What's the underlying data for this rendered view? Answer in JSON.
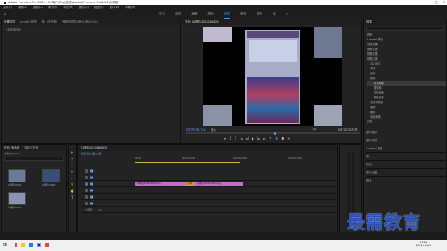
{
  "titlebar": {
    "title": "Adobe Premiere Pro 2020 - C:\\用户\\Ghp\\文档\\Adobe\\Premiere Pro\\14.0\\未命名 *",
    "minimize": "—",
    "maximize": "□",
    "close": "✕"
  },
  "menu": [
    "文件(F)",
    "编辑(E)",
    "剪辑(C)",
    "序列(S)",
    "标记(M)",
    "图形(G)",
    "视图(V)",
    "窗口(W)",
    "帮助(H)"
  ],
  "workspaces": [
    "学习",
    "组件",
    "编辑",
    "颜色",
    "效果",
    "音频",
    "图形",
    "库",
    "»"
  ],
  "active_workspace": "效果",
  "source_panel": {
    "tabs": [
      "效果控件",
      "Lumetri 范围",
      "源：(无剪辑)",
      "音频剪辑混合器:01图片2020"
    ],
    "placeholder": "（未选择剪辑）"
  },
  "program_panel": {
    "tab": "节目: 01图片2020180605",
    "timecode": "00:00:01:03",
    "fit": "适合",
    "quality": "1/2",
    "duration": "00:00:10:00"
  },
  "effects_panel": {
    "tab": "效果",
    "items": [
      "预设",
      "Lumetri 预设",
      "音频效果",
      "音频过渡",
      "视频效果",
      "视频过渡",
      "3D 运动",
      "内滑",
      "划像",
      "擦除",
      "交叉划像",
      "圆划像",
      "盒形划像",
      "菱形划像",
      "沉浸式视频",
      "溶解",
      "缩放",
      "页面剥落",
      "过时"
    ],
    "selected": "交叉划像",
    "sections": [
      "基本图形",
      "基本声音",
      "Lumetri 颜色",
      "库",
      "标记",
      "历史记录",
      "信息"
    ]
  },
  "project_panel": {
    "tabs": [
      "项目: 未命名",
      "媒体浏览器"
    ],
    "name": "未命名.prproj",
    "clips": [
      "01图片2020",
      "02图片2020",
      "03图片2020"
    ]
  },
  "timeline": {
    "tab": "01图片2020180605",
    "timecode": "00:00:01:03",
    "ruler": [
      "00:00",
      "00:00:05:00",
      "00:00:10:00",
      "00:00:15:00"
    ],
    "tracks": [
      "V3",
      "V2",
      "V1",
      "A1",
      "A2",
      "A3",
      "主声道"
    ],
    "master_value": "0.0",
    "clip1": "02图片2020180605.jpg",
    "transition": "交叉划像",
    "clip2": "01图片2020180605.jpg"
  },
  "taskbar": {
    "time": "17:12",
    "date": "2021/10/15"
  },
  "watermark": "最需教育"
}
